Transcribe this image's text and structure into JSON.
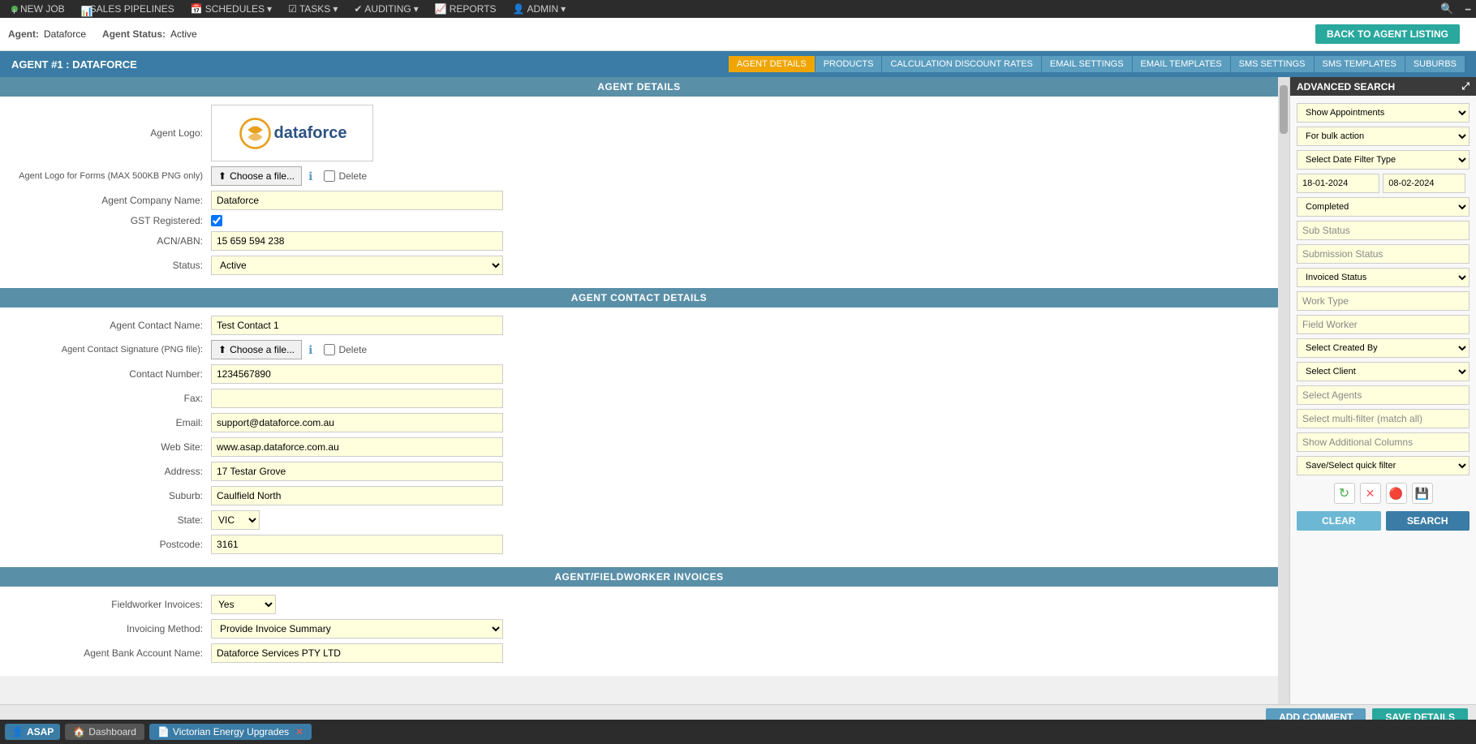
{
  "topNav": {
    "items": [
      {
        "label": "NEW JOB",
        "color": "#4CAF50",
        "hasDropdown": false
      },
      {
        "label": "SALES PIPELINES",
        "color": "#2196F3",
        "hasDropdown": false
      },
      {
        "label": "SCHEDULES",
        "color": "#FF9800",
        "hasDropdown": true
      },
      {
        "label": "TASKS",
        "color": "#9C27B0",
        "hasDropdown": true
      },
      {
        "label": "AUDITING",
        "color": "#009688",
        "hasDropdown": true
      },
      {
        "label": "REPORTS",
        "color": "#4CAF50",
        "hasDropdown": false
      },
      {
        "label": "ADMIN",
        "color": "#FF5722",
        "hasDropdown": true
      }
    ]
  },
  "agentStatusBar": {
    "agentLabel": "Agent:",
    "agentValue": "Dataforce",
    "statusLabel": "Agent Status:",
    "statusValue": "Active"
  },
  "pageHeader": {
    "title": "AGENT #1 : DATAFORCE",
    "backButton": "BACK TO AGENT LISTING",
    "tabs": [
      "AGENT DETAILS",
      "PRODUCTS",
      "CALCULATION DISCOUNT RATES",
      "EMAIL SETTINGS",
      "EMAIL TEMPLATES",
      "SMS SETTINGS",
      "SMS TEMPLATES",
      "SUBURBS"
    ],
    "activeTab": "AGENT DETAILS"
  },
  "agentDetails": {
    "sectionTitle": "AGENT DETAILS",
    "fields": {
      "agentLogoLabel": "Agent Logo:",
      "agentLogoForFormsLabel": "Agent Logo for Forms (MAX 500KB PNG only)",
      "chooseFileLabel": "Choose a file...",
      "deleteLabel": "Delete",
      "agentCompanyNameLabel": "Agent Company Name:",
      "agentCompanyNameValue": "Dataforce",
      "gstRegisteredLabel": "GST Registered:",
      "gstRegisteredChecked": true,
      "acnAbnLabel": "ACN/ABN:",
      "acnAbnValue": "15 659 594 238",
      "statusLabel": "Status:",
      "statusValue": "Active"
    }
  },
  "agentContactDetails": {
    "sectionTitle": "AGENT CONTACT DETAILS",
    "fields": {
      "contactNameLabel": "Agent Contact Name:",
      "contactNameValue": "Test Contact 1",
      "contactSignatureLabel": "Agent Contact Signature (PNG file):",
      "contactNumberLabel": "Contact Number:",
      "contactNumberValue": "1234567890",
      "faxLabel": "Fax:",
      "faxValue": "",
      "emailLabel": "Email:",
      "emailValue": "support@dataforce.com.au",
      "webSiteLabel": "Web Site:",
      "webSiteValue": "www.asap.dataforce.com.au",
      "addressLabel": "Address:",
      "addressValue": "17 Testar Grove",
      "suburbLabel": "Suburb:",
      "suburbValue": "Caulfield North",
      "stateLabel": "State:",
      "stateValue": "VIC",
      "postcodeLabel": "Postcode:",
      "postcodeValue": "3161"
    }
  },
  "agentInvoices": {
    "sectionTitle": "AGENT/FIELDWORKER INVOICES",
    "fields": {
      "fieldworkerInvoicesLabel": "Fieldworker Invoices:",
      "fieldworkerInvoicesValue": "Yes",
      "invoicingMethodLabel": "Invoicing Method:",
      "invoicingMethodValue": "Provide Invoice Summary",
      "agentBankAccountLabel": "Agent Bank Account Name:",
      "agentBankAccountValue": "Dataforce Services PTY LTD"
    }
  },
  "bottomBar": {
    "addCommentLabel": "ADD COMMENT",
    "saveDetailsLabel": "SAVE DETAILS"
  },
  "advancedSearch": {
    "title": "ADVANCED SEARCH",
    "showAppointmentsLabel": "Show Appointments",
    "forBulkActionLabel": "For bulk action",
    "selectDateFilterTypeLabel": "Select Date Filter Type",
    "dateFrom": "18-01-2024",
    "dateTo": "08-02-2024",
    "completedLabel": "Completed",
    "subStatusLabel": "Sub Status",
    "submissionStatusLabel": "Submission Status",
    "invoicedStatusLabel": "Invoiced Status",
    "workTypeLabel": "Work Type",
    "fieldWorkerLabel": "Field Worker",
    "selectCreatedByLabel": "Select Created By",
    "selectClientLabel": "Select Client",
    "selectAgentsLabel": "Select Agents",
    "selectMultiFilterLabel": "Select multi-filter (match all)",
    "showAdditionalColumnsLabel": "Show Additional Columns",
    "saveSelectQuickFilterLabel": "Save/Select quick filter",
    "clearLabel": "CLEAR",
    "searchLabel": "SEARCH",
    "iconRefresh": "↻",
    "iconCancel": "✕",
    "iconSave1": "🔴",
    "iconSave2": "💾"
  },
  "taskbar": {
    "asapLabel": "ASAP",
    "dashboardLabel": "Dashboard",
    "activeTabLabel": "Victorian Energy Upgrades"
  }
}
